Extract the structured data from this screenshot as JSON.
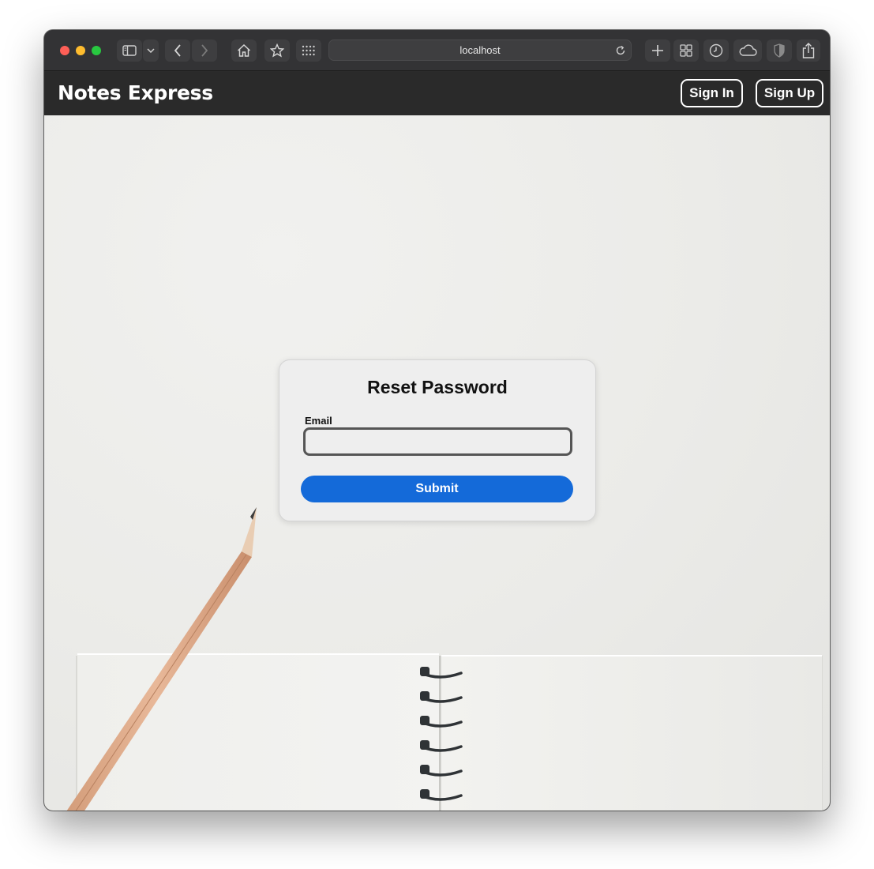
{
  "browser": {
    "url": "localhost"
  },
  "header": {
    "brand": "Notes Express",
    "sign_in_label": "Sign In",
    "sign_up_label": "Sign Up"
  },
  "reset_form": {
    "title": "Reset Password",
    "email_label": "Email",
    "email_value": "",
    "submit_label": "Submit"
  },
  "colors": {
    "header_bg": "#2a2a2a",
    "submit_bg": "#146ad9",
    "card_bg": "#eeeeee"
  }
}
